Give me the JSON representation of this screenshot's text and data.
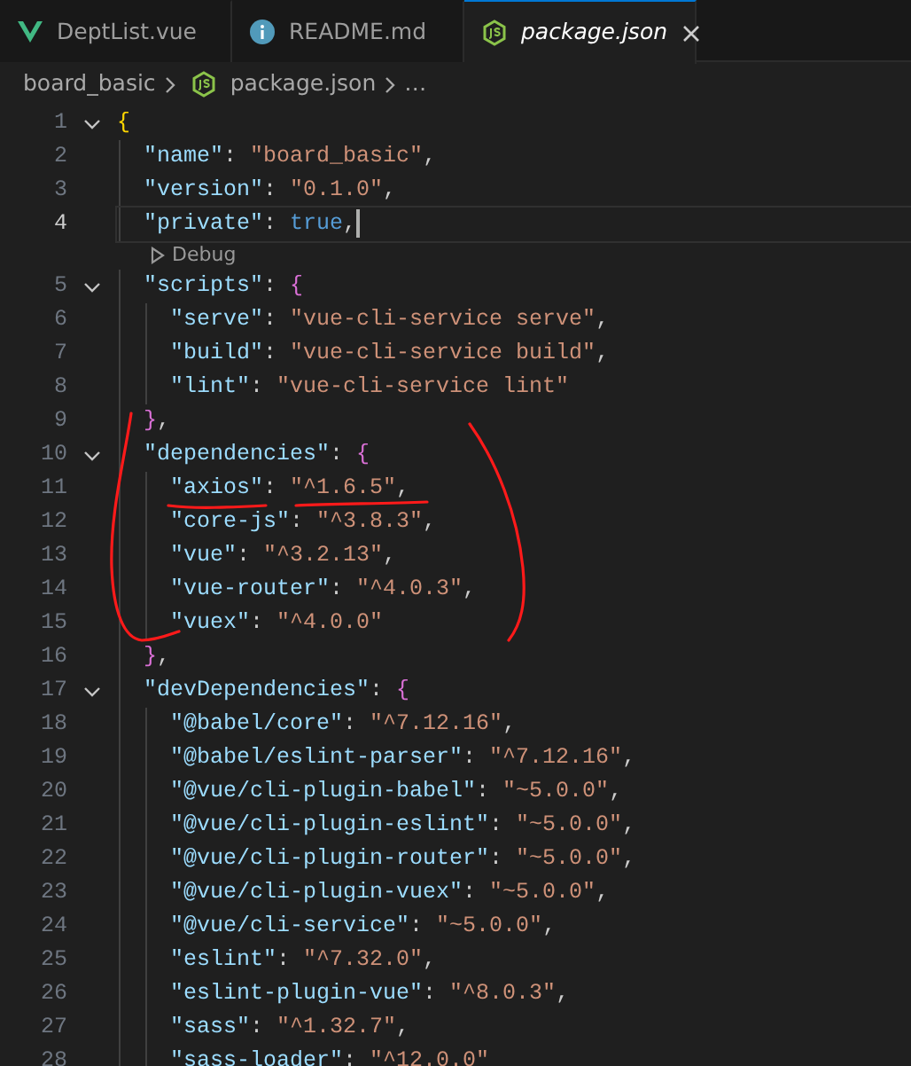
{
  "tabs": [
    {
      "label": "DeptList.vue",
      "kind": "vue",
      "selected": false,
      "preview": false
    },
    {
      "label": "README.md",
      "kind": "info",
      "selected": false,
      "preview": false
    },
    {
      "label": "package.json",
      "kind": "node",
      "selected": true,
      "preview": true
    }
  ],
  "breadcrumb": [
    {
      "label": "board_basic",
      "kind": "folder"
    },
    {
      "label": "package.json",
      "kind": "node"
    },
    {
      "label": "…",
      "kind": "more"
    }
  ],
  "lines": [
    {
      "number": "1",
      "fold": true,
      "current": false,
      "tokens": [
        {
          "kind": "brace1",
          "text": "{"
        }
      ],
      "children": [
        {
          "number": "2",
          "fold": false,
          "current": false,
          "tokens": [
            {
              "kind": "key",
              "text": "\"name\""
            },
            {
              "kind": "punct",
              "text": ": "
            },
            {
              "kind": "string",
              "text": "\"board_basic\""
            },
            {
              "kind": "punct",
              "text": ","
            }
          ]
        },
        {
          "number": "3",
          "fold": false,
          "current": false,
          "tokens": [
            {
              "kind": "key",
              "text": "\"version\""
            },
            {
              "kind": "punct",
              "text": ": "
            },
            {
              "kind": "string",
              "text": "\"0.1.0\""
            },
            {
              "kind": "punct",
              "text": ","
            }
          ]
        },
        {
          "number": "4",
          "fold": false,
          "current": true,
          "codelens": "Debug",
          "tokens": [
            {
              "kind": "key",
              "text": "\"private\""
            },
            {
              "kind": "punct",
              "text": ": "
            },
            {
              "kind": "keyword",
              "text": "true"
            },
            {
              "kind": "punct",
              "text": ","
            }
          ]
        },
        {
          "number": "5",
          "fold": true,
          "current": false,
          "tokens": [
            {
              "kind": "key",
              "text": "\"scripts\""
            },
            {
              "kind": "punct",
              "text": ": "
            },
            {
              "kind": "brace2",
              "text": "{"
            }
          ],
          "children": [
            {
              "number": "6",
              "fold": false,
              "current": false,
              "tokens": [
                {
                  "kind": "key",
                  "text": "\"serve\""
                },
                {
                  "kind": "punct",
                  "text": ": "
                },
                {
                  "kind": "string",
                  "text": "\"vue-cli-service serve\""
                },
                {
                  "kind": "punct",
                  "text": ","
                }
              ]
            },
            {
              "number": "7",
              "fold": false,
              "current": false,
              "tokens": [
                {
                  "kind": "key",
                  "text": "\"build\""
                },
                {
                  "kind": "punct",
                  "text": ": "
                },
                {
                  "kind": "string",
                  "text": "\"vue-cli-service build\""
                },
                {
                  "kind": "punct",
                  "text": ","
                }
              ]
            },
            {
              "number": "8",
              "fold": false,
              "current": false,
              "tokens": [
                {
                  "kind": "key",
                  "text": "\"lint\""
                },
                {
                  "kind": "punct",
                  "text": ": "
                },
                {
                  "kind": "string",
                  "text": "\"vue-cli-service lint\""
                }
              ]
            }
          ]
        },
        {
          "number": "9",
          "fold": false,
          "current": false,
          "tokens": [
            {
              "kind": "brace2",
              "text": "}"
            },
            {
              "kind": "punct",
              "text": ","
            }
          ]
        },
        {
          "number": "10",
          "fold": true,
          "current": false,
          "tokens": [
            {
              "kind": "key",
              "text": "\"dependencies\""
            },
            {
              "kind": "punct",
              "text": ": "
            },
            {
              "kind": "brace2",
              "text": "{"
            }
          ],
          "children": [
            {
              "number": "11",
              "fold": false,
              "current": false,
              "tokens": [
                {
                  "kind": "key",
                  "text": "\"axios\""
                },
                {
                  "kind": "punct",
                  "text": ": "
                },
                {
                  "kind": "string",
                  "text": "\"^1.6.5\""
                },
                {
                  "kind": "punct",
                  "text": ","
                }
              ]
            },
            {
              "number": "12",
              "fold": false,
              "current": false,
              "tokens": [
                {
                  "kind": "key",
                  "text": "\"core-js\""
                },
                {
                  "kind": "punct",
                  "text": ": "
                },
                {
                  "kind": "string",
                  "text": "\"^3.8.3\""
                },
                {
                  "kind": "punct",
                  "text": ","
                }
              ]
            },
            {
              "number": "13",
              "fold": false,
              "current": false,
              "tokens": [
                {
                  "kind": "key",
                  "text": "\"vue\""
                },
                {
                  "kind": "punct",
                  "text": ": "
                },
                {
                  "kind": "string",
                  "text": "\"^3.2.13\""
                },
                {
                  "kind": "punct",
                  "text": ","
                }
              ]
            },
            {
              "number": "14",
              "fold": false,
              "current": false,
              "tokens": [
                {
                  "kind": "key",
                  "text": "\"vue-router\""
                },
                {
                  "kind": "punct",
                  "text": ": "
                },
                {
                  "kind": "string",
                  "text": "\"^4.0.3\""
                },
                {
                  "kind": "punct",
                  "text": ","
                }
              ]
            },
            {
              "number": "15",
              "fold": false,
              "current": false,
              "tokens": [
                {
                  "kind": "key",
                  "text": "\"vuex\""
                },
                {
                  "kind": "punct",
                  "text": ": "
                },
                {
                  "kind": "string",
                  "text": "\"^4.0.0\""
                }
              ]
            }
          ]
        },
        {
          "number": "16",
          "fold": false,
          "current": false,
          "tokens": [
            {
              "kind": "brace2",
              "text": "}"
            },
            {
              "kind": "punct",
              "text": ","
            }
          ]
        },
        {
          "number": "17",
          "fold": true,
          "current": false,
          "tokens": [
            {
              "kind": "key",
              "text": "\"devDependencies\""
            },
            {
              "kind": "punct",
              "text": ": "
            },
            {
              "kind": "brace2",
              "text": "{"
            }
          ],
          "children": [
            {
              "number": "18",
              "fold": false,
              "current": false,
              "tokens": [
                {
                  "kind": "key",
                  "text": "\"@babel/core\""
                },
                {
                  "kind": "punct",
                  "text": ": "
                },
                {
                  "kind": "string",
                  "text": "\"^7.12.16\""
                },
                {
                  "kind": "punct",
                  "text": ","
                }
              ]
            },
            {
              "number": "19",
              "fold": false,
              "current": false,
              "tokens": [
                {
                  "kind": "key",
                  "text": "\"@babel/eslint-parser\""
                },
                {
                  "kind": "punct",
                  "text": ": "
                },
                {
                  "kind": "string",
                  "text": "\"^7.12.16\""
                },
                {
                  "kind": "punct",
                  "text": ","
                }
              ]
            },
            {
              "number": "20",
              "fold": false,
              "current": false,
              "tokens": [
                {
                  "kind": "key",
                  "text": "\"@vue/cli-plugin-babel\""
                },
                {
                  "kind": "punct",
                  "text": ": "
                },
                {
                  "kind": "string",
                  "text": "\"~5.0.0\""
                },
                {
                  "kind": "punct",
                  "text": ","
                }
              ]
            },
            {
              "number": "21",
              "fold": false,
              "current": false,
              "tokens": [
                {
                  "kind": "key",
                  "text": "\"@vue/cli-plugin-eslint\""
                },
                {
                  "kind": "punct",
                  "text": ": "
                },
                {
                  "kind": "string",
                  "text": "\"~5.0.0\""
                },
                {
                  "kind": "punct",
                  "text": ","
                }
              ]
            },
            {
              "number": "22",
              "fold": false,
              "current": false,
              "tokens": [
                {
                  "kind": "key",
                  "text": "\"@vue/cli-plugin-router\""
                },
                {
                  "kind": "punct",
                  "text": ": "
                },
                {
                  "kind": "string",
                  "text": "\"~5.0.0\""
                },
                {
                  "kind": "punct",
                  "text": ","
                }
              ]
            },
            {
              "number": "23",
              "fold": false,
              "current": false,
              "tokens": [
                {
                  "kind": "key",
                  "text": "\"@vue/cli-plugin-vuex\""
                },
                {
                  "kind": "punct",
                  "text": ": "
                },
                {
                  "kind": "string",
                  "text": "\"~5.0.0\""
                },
                {
                  "kind": "punct",
                  "text": ","
                }
              ]
            },
            {
              "number": "24",
              "fold": false,
              "current": false,
              "tokens": [
                {
                  "kind": "key",
                  "text": "\"@vue/cli-service\""
                },
                {
                  "kind": "punct",
                  "text": ": "
                },
                {
                  "kind": "string",
                  "text": "\"~5.0.0\""
                },
                {
                  "kind": "punct",
                  "text": ","
                }
              ]
            },
            {
              "number": "25",
              "fold": false,
              "current": false,
              "tokens": [
                {
                  "kind": "key",
                  "text": "\"eslint\""
                },
                {
                  "kind": "punct",
                  "text": ": "
                },
                {
                  "kind": "string",
                  "text": "\"^7.32.0\""
                },
                {
                  "kind": "punct",
                  "text": ","
                }
              ]
            },
            {
              "number": "26",
              "fold": false,
              "current": false,
              "tokens": [
                {
                  "kind": "key",
                  "text": "\"eslint-plugin-vue\""
                },
                {
                  "kind": "punct",
                  "text": ": "
                },
                {
                  "kind": "string",
                  "text": "\"^8.0.3\""
                },
                {
                  "kind": "punct",
                  "text": ","
                }
              ]
            },
            {
              "number": "27",
              "fold": false,
              "current": false,
              "tokens": [
                {
                  "kind": "key",
                  "text": "\"sass\""
                },
                {
                  "kind": "punct",
                  "text": ": "
                },
                {
                  "kind": "string",
                  "text": "\"^1.32.7\""
                },
                {
                  "kind": "punct",
                  "text": ","
                }
              ]
            },
            {
              "number": "28",
              "fold": false,
              "current": false,
              "tokens": [
                {
                  "kind": "key",
                  "text": "\"sass-loader\""
                },
                {
                  "kind": "punct",
                  "text": ": "
                },
                {
                  "kind": "string",
                  "text": "\"^12.0.0\""
                }
              ]
            }
          ]
        }
      ]
    }
  ],
  "pen_marks": [
    {
      "kind": "left-arc"
    },
    {
      "kind": "right-arc"
    },
    {
      "kind": "underline-key"
    },
    {
      "kind": "underline-value"
    }
  ]
}
